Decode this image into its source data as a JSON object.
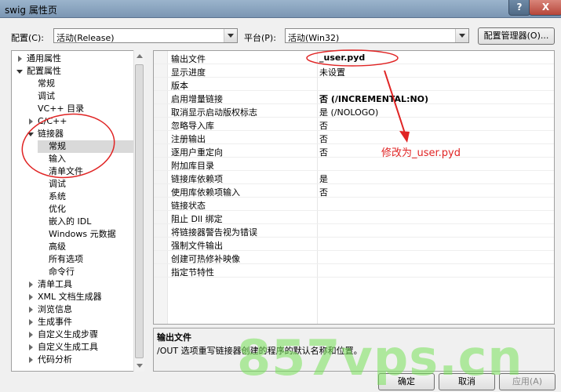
{
  "window": {
    "title": "swig 属性页",
    "help_label": "?",
    "close_label": "X"
  },
  "config": {
    "config_label": "配置(C):",
    "config_value": "活动(Release)",
    "platform_label": "平台(P):",
    "platform_value": "活动(Win32)",
    "manager_label": "配置管理器(O)..."
  },
  "tree": {
    "items": [
      {
        "label": "通用属性"
      },
      {
        "label": "配置属性"
      },
      {
        "label": "常规"
      },
      {
        "label": "调试"
      },
      {
        "label": "VC++ 目录"
      },
      {
        "label": "C/C++"
      },
      {
        "label": "链接器"
      },
      {
        "label": "常规"
      },
      {
        "label": "输入"
      },
      {
        "label": "清单文件"
      },
      {
        "label": "调试"
      },
      {
        "label": "系统"
      },
      {
        "label": "优化"
      },
      {
        "label": "嵌入的 IDL"
      },
      {
        "label": "Windows 元数据"
      },
      {
        "label": "高级"
      },
      {
        "label": "所有选项"
      },
      {
        "label": "命令行"
      },
      {
        "label": "清单工具"
      },
      {
        "label": "XML 文档生成器"
      },
      {
        "label": "浏览信息"
      },
      {
        "label": "生成事件"
      },
      {
        "label": "自定义生成步骤"
      },
      {
        "label": "自定义生成工具"
      },
      {
        "label": "代码分析"
      }
    ]
  },
  "grid": {
    "rows": [
      {
        "name": "输出文件",
        "value": "_user.pyd"
      },
      {
        "name": "显示进度",
        "value": "未设置"
      },
      {
        "name": "版本",
        "value": ""
      },
      {
        "name": "启用增量链接",
        "value": "否 (/INCREMENTAL:NO)"
      },
      {
        "name": "取消显示启动版权标志",
        "value": "是 (/NOLOGO)"
      },
      {
        "name": "忽略导入库",
        "value": "否"
      },
      {
        "name": "注册输出",
        "value": "否"
      },
      {
        "name": "逐用户重定向",
        "value": "否"
      },
      {
        "name": "附加库目录",
        "value": ""
      },
      {
        "name": "链接库依赖项",
        "value": "是"
      },
      {
        "name": "使用库依赖项输入",
        "value": "否"
      },
      {
        "name": "链接状态",
        "value": ""
      },
      {
        "name": "阻止 Dll 绑定",
        "value": ""
      },
      {
        "name": "将链接器警告视为错误",
        "value": ""
      },
      {
        "name": "强制文件输出",
        "value": ""
      },
      {
        "name": "创建可热修补映像",
        "value": ""
      },
      {
        "name": "指定节特性",
        "value": ""
      }
    ]
  },
  "description": {
    "title": "输出文件",
    "text": "/OUT 选项重写链接器创建的程序的默认名称和位置。"
  },
  "annotation": {
    "text": "修改为_user.pyd",
    "color": "#e02424"
  },
  "watermark": {
    "text": "857vps.cn"
  },
  "buttons": {
    "ok": "确定",
    "cancel": "取消",
    "apply": "应用(A)"
  }
}
